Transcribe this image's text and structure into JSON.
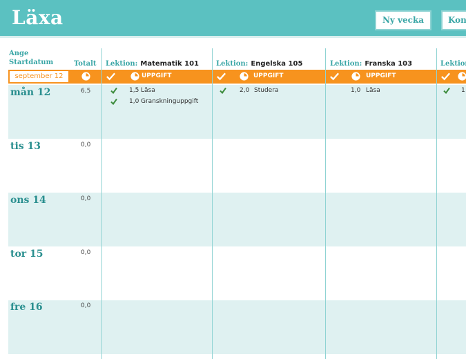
{
  "app": {
    "title": "Läxa",
    "buttons": {
      "new_week": "Ny vecka",
      "config": "Konfi"
    }
  },
  "start_date": {
    "label_line1": "Ange",
    "label_line2": "Startdatum",
    "value": "september 12"
  },
  "total_label": "Totalt",
  "lesson_label": "Lektion:",
  "task_header": "UPPGIFT",
  "lessons": [
    {
      "name": "Matematik 101"
    },
    {
      "name": "Engelska 105"
    },
    {
      "name": "Franska 103"
    }
  ],
  "days": [
    {
      "label": "mån 12",
      "total": "6,5"
    },
    {
      "label": "tis 13",
      "total": "0,0"
    },
    {
      "label": "ons 14",
      "total": "0,0"
    },
    {
      "label": "tor 15",
      "total": "0,0"
    },
    {
      "label": "fre 16",
      "total": "0,0"
    }
  ],
  "tasks": {
    "mat_1": {
      "hours": "1,5",
      "text": "Läsa",
      "done": true
    },
    "mat_2": {
      "hours": "1,0",
      "text": "Granskninguppgift",
      "done": true
    },
    "eng_1": {
      "hours": "2,0",
      "text": "Studera",
      "done": true
    },
    "fra_1": {
      "hours": "1,0",
      "text": "Läsa",
      "done": false
    },
    "col4_1": {
      "hours": "1",
      "done": true
    }
  },
  "colors": {
    "teal": "#5bc1c1",
    "orange": "#f7931e",
    "row_alt": "#dff1f1",
    "check": "#3a8a3a"
  }
}
